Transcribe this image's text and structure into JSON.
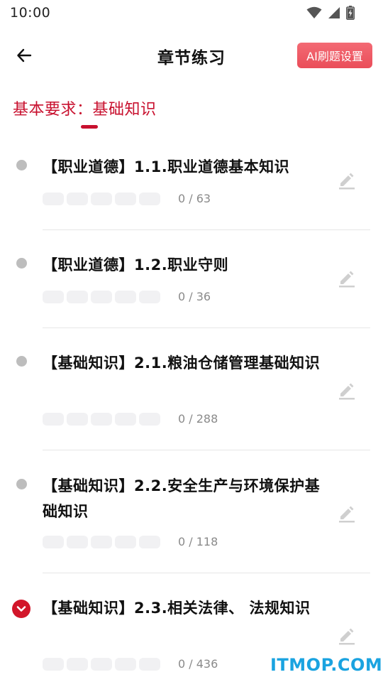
{
  "status_bar": {
    "time": "10:00",
    "icons": [
      "wifi-icon",
      "cellular-signal-icon",
      "battery-charging-icon"
    ]
  },
  "header": {
    "back_icon": "arrow-left-icon",
    "title": "章节练习",
    "ai_button_label": "AI刷题设置"
  },
  "category": {
    "label": "基本要求：基础知识"
  },
  "chapters": [
    {
      "title": "【职业道德】1.1.职业道德基本知识",
      "progress": "0 / 63",
      "state": "dot"
    },
    {
      "title": "【职业道德】1.2.职业守则",
      "progress": "0 / 36",
      "state": "dot"
    },
    {
      "title": "【基础知识】2.1.粮油仓储管理基础知识",
      "progress": "0 / 288",
      "state": "dot"
    },
    {
      "title": "【基础知识】2.2.安全生产与环境保护基础知识",
      "progress": "0 / 118",
      "state": "dot"
    },
    {
      "title": "【基础知识】2.3.相关法律、 法规知识",
      "progress": "0 / 436",
      "state": "expanded"
    }
  ],
  "watermark": "ITMOP.COM",
  "colors": {
    "accent": "#c8102e",
    "ai_button": "#ea4d59",
    "dot_gray": "#bdbdbd",
    "watermark": "#1aa3e0"
  }
}
